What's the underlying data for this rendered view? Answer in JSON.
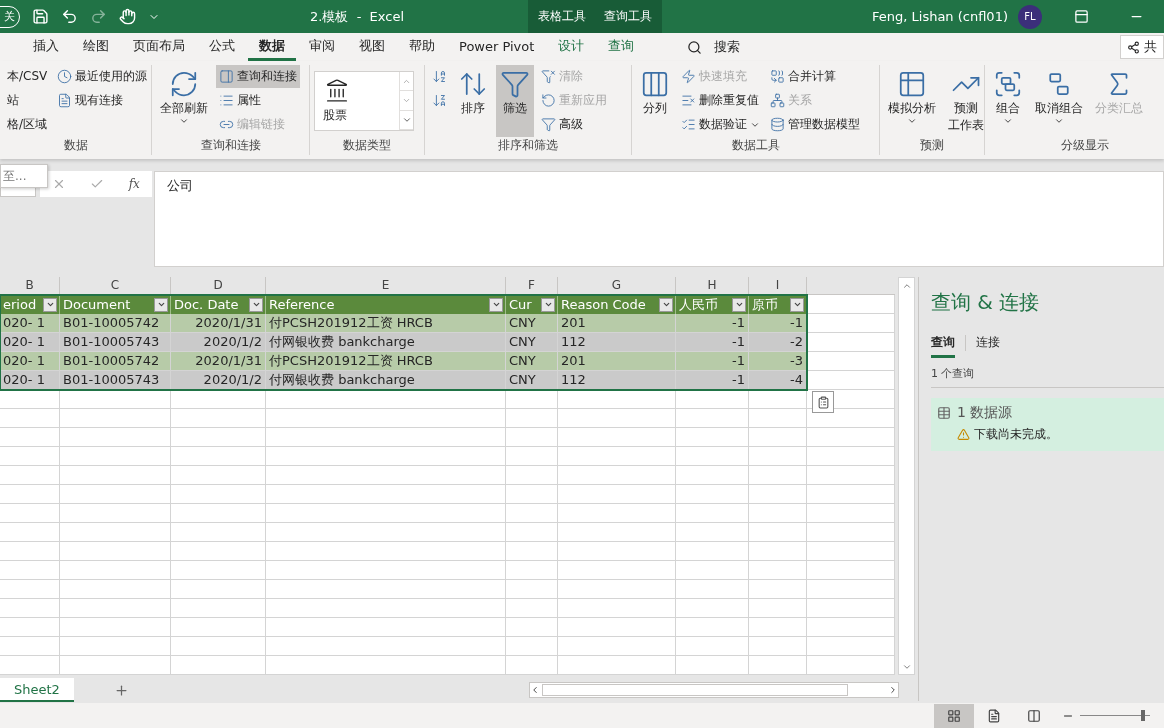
{
  "title_bar": {
    "qat_label": "关",
    "title": "2.模板  -  Excel",
    "context_tabs": [
      "表格工具",
      "查询工具"
    ],
    "user": "Feng, Lishan (cnfl01)",
    "avatar": "FL"
  },
  "tabs": [
    {
      "label": "插入",
      "selected": false,
      "contextual": false
    },
    {
      "label": "绘图",
      "selected": false,
      "contextual": false
    },
    {
      "label": "页面布局",
      "selected": false,
      "contextual": false
    },
    {
      "label": "公式",
      "selected": false,
      "contextual": false
    },
    {
      "label": "数据",
      "selected": true,
      "contextual": false
    },
    {
      "label": "审阅",
      "selected": false,
      "contextual": false
    },
    {
      "label": "视图",
      "selected": false,
      "contextual": false
    },
    {
      "label": "帮助",
      "selected": false,
      "contextual": false
    },
    {
      "label": "Power Pivot",
      "selected": false,
      "contextual": false
    },
    {
      "label": "设计",
      "selected": false,
      "contextual": true
    },
    {
      "label": "查询",
      "selected": false,
      "contextual": true
    }
  ],
  "search": {
    "label": "搜索"
  },
  "share": {
    "label": "共"
  },
  "ribbon": {
    "groups": [
      {
        "label": "数据",
        "items": [
          {
            "kind": "stack",
            "items": [
              {
                "label": "本/CSV",
                "disabled": false,
                "selected": false
              },
              {
                "label": "站",
                "disabled": false,
                "selected": false
              },
              {
                "label": "格/区域",
                "disabled": false,
                "selected": false
              }
            ]
          },
          {
            "kind": "stack",
            "items": [
              {
                "label": "最近使用的源",
                "disabled": false,
                "selected": false
              },
              {
                "label": "现有连接",
                "disabled": false,
                "selected": false
              }
            ]
          }
        ]
      },
      {
        "label": "查询和连接",
        "items": [
          {
            "kind": "large",
            "label": "全部刷新",
            "caret": true,
            "disabled": false,
            "selected": false
          },
          {
            "kind": "stack",
            "items": [
              {
                "label": "查询和连接",
                "disabled": false,
                "selected": true
              },
              {
                "label": "属性",
                "disabled": false,
                "selected": false
              },
              {
                "label": "编辑链接",
                "disabled": true,
                "selected": false
              }
            ]
          }
        ]
      },
      {
        "label": "数据类型",
        "items": [
          {
            "kind": "gallery",
            "label": "股票"
          }
        ]
      },
      {
        "label": "排序和筛选",
        "items": [
          {
            "kind": "sort_pair"
          },
          {
            "kind": "large",
            "label": "排序",
            "caret": false,
            "disabled": false,
            "selected": false
          },
          {
            "kind": "large",
            "label": "筛选",
            "caret": false,
            "disabled": false,
            "selected": true
          },
          {
            "kind": "stack",
            "items": [
              {
                "label": "清除",
                "disabled": true,
                "selected": false
              },
              {
                "label": "重新应用",
                "disabled": true,
                "selected": false
              },
              {
                "label": "高级",
                "disabled": false,
                "selected": false
              }
            ]
          }
        ]
      },
      {
        "label": "数据工具",
        "items": [
          {
            "kind": "large",
            "label": "分列",
            "caret": false,
            "disabled": false,
            "selected": false
          },
          {
            "kind": "stack",
            "items": [
              {
                "label": "快速填充",
                "disabled": true,
                "selected": false
              },
              {
                "label": "删除重复值",
                "disabled": false,
                "selected": false
              },
              {
                "label": "数据验证",
                "caret": true,
                "disabled": false,
                "selected": false
              }
            ]
          },
          {
            "kind": "stack",
            "items": [
              {
                "label": "合并计算",
                "disabled": false,
                "selected": false
              },
              {
                "label": "关系",
                "disabled": true,
                "selected": false
              },
              {
                "label": "管理数据模型",
                "disabled": false,
                "selected": false
              }
            ]
          }
        ]
      },
      {
        "label": "预测",
        "items": [
          {
            "kind": "large",
            "label": "模拟分析",
            "caret": true,
            "disabled": false,
            "selected": false
          },
          {
            "kind": "large",
            "lines": [
              "预测",
              "工作表"
            ],
            "caret": false,
            "disabled": false,
            "selected": false
          }
        ]
      },
      {
        "label": "分级显示",
        "items": [
          {
            "kind": "large",
            "label": "组合",
            "caret": true,
            "disabled": false,
            "selected": false
          },
          {
            "kind": "large",
            "label": "取消组合",
            "caret": true,
            "disabled": false,
            "selected": false
          },
          {
            "kind": "large",
            "label": "分类汇总",
            "caret": false,
            "disabled": true,
            "selected": false
          }
        ]
      }
    ]
  },
  "popup": {
    "items": [
      "至..."
    ]
  },
  "formula_bar": {
    "fx_label": "fx",
    "value": "公司"
  },
  "sheet": {
    "column_letters": [
      "B",
      "C",
      "D",
      "E",
      "F",
      "G",
      "H",
      "I"
    ],
    "table": {
      "columns": [
        "eriod",
        "Document",
        "Doc. Date",
        "Reference",
        "Cur",
        "Reason Code",
        "人民币",
        "原币"
      ],
      "rows": [
        [
          "020- 1",
          "B01-10005742",
          "2020/1/31",
          "付PCSH201912工资 HRCB",
          "CNY",
          "201",
          "-1",
          "-1"
        ],
        [
          "020- 1",
          "B01-10005743",
          "2020/1/2",
          "付网银收费 bankcharge",
          "CNY",
          "112",
          "-1",
          "-2"
        ],
        [
          "020- 1",
          "B01-10005742",
          "2020/1/31",
          "付PCSH201912工资 HRCB",
          "CNY",
          "201",
          "-1",
          "-3"
        ],
        [
          "020- 1",
          "B01-10005743",
          "2020/1/2",
          "付网银收费 bankcharge",
          "CNY",
          "112",
          "-1",
          "-4"
        ]
      ]
    }
  },
  "query_pane": {
    "title": "查询 & 连接",
    "tabs": [
      {
        "label": "查询",
        "selected": true
      },
      {
        "label": "连接",
        "selected": false
      }
    ],
    "count": "1 个查询",
    "items": [
      {
        "label": "1 数据源",
        "status": "下载尚未完成。"
      }
    ]
  },
  "sheet_tabs": [
    {
      "label": "Sheet2",
      "selected": true
    }
  ],
  "status_bar": {
    "views": [
      {
        "selected": true
      },
      {
        "selected": false
      },
      {
        "selected": false
      }
    ],
    "zoom": {
      "level": 0.9
    }
  }
}
